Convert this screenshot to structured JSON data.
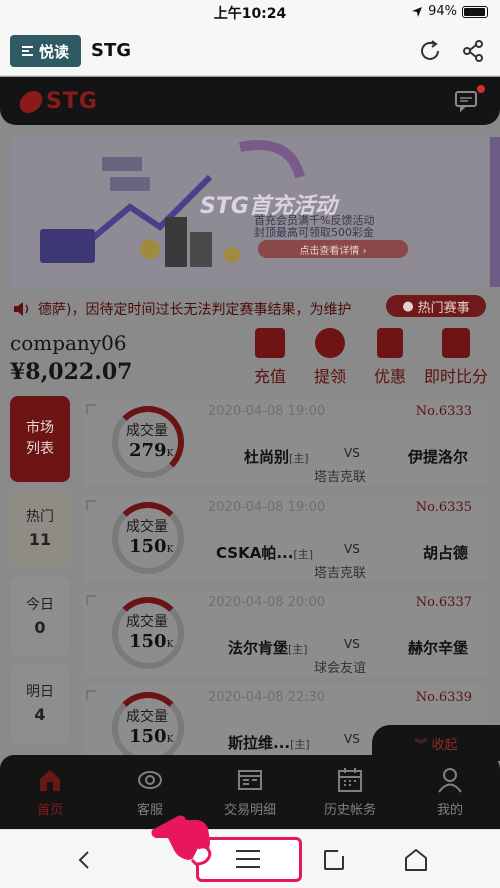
{
  "status": {
    "time": "上午10:24",
    "battery": "94%",
    "battery_level": 0.94
  },
  "header": {
    "reader_label": "悦读",
    "title": "STG"
  },
  "topbar": {
    "logo": "STG"
  },
  "banner": {
    "brand": "STG首充活动",
    "line1": "首充会员满千%反馈活动",
    "line2": "封顶最高可领取500彩金",
    "cta": "点击查看详情 ›"
  },
  "notice": {
    "text": "德萨)，因待定时间过长无法判定赛事结果，为维护",
    "hot_button": "热门赛事"
  },
  "account": {
    "name": "company06",
    "balance": "¥8,022.07"
  },
  "quick_actions": [
    {
      "label": "充值",
      "icon": "deposit-icon"
    },
    {
      "label": "提领",
      "icon": "withdraw-icon"
    },
    {
      "label": "优惠",
      "icon": "coupon-icon"
    },
    {
      "label": "即时比分",
      "icon": "scoreboard-icon"
    }
  ],
  "side_tabs": [
    {
      "label": "市场\n列表",
      "line1": "市场",
      "line2": "列表",
      "active": true
    },
    {
      "line1": "热门",
      "line2": "11"
    },
    {
      "line1": "今日",
      "line2": "0"
    },
    {
      "line1": "明日",
      "line2": "4"
    }
  ],
  "matches": [
    {
      "vol_label": "成交量",
      "volume": "279",
      "unit": "K",
      "date": "2020-04-08 19:00",
      "no": "No.6333",
      "home": "杜尚别",
      "home_tag": "[主]",
      "vs": "VS",
      "away": "伊提洛尔",
      "league": "塔吉克联"
    },
    {
      "vol_label": "成交量",
      "volume": "150",
      "unit": "K",
      "date": "2020-04-08 19:00",
      "no": "No.6335",
      "home": "CSKA帕...",
      "home_tag": "[主]",
      "vs": "VS",
      "away": "胡占德",
      "league": "塔吉克联"
    },
    {
      "vol_label": "成交量",
      "volume": "150",
      "unit": "K",
      "date": "2020-04-08 20:00",
      "no": "No.6337",
      "home": "法尔肯堡",
      "home_tag": "[主]",
      "vs": "VS",
      "away": "赫尔辛堡",
      "league": "球会友谊"
    },
    {
      "vol_label": "成交量",
      "volume": "150",
      "unit": "K",
      "date": "2020-04-08 22:30",
      "no": "No.6339",
      "home": "斯拉维...",
      "home_tag": "[主]",
      "vs": "VS",
      "away": "",
      "league": ""
    }
  ],
  "collapse_label": "收起",
  "tabbar": [
    {
      "label": "首页",
      "icon": "home-icon",
      "active": true
    },
    {
      "label": "客服",
      "icon": "support-icon"
    },
    {
      "label": "交易明细",
      "icon": "transactions-icon"
    },
    {
      "label": "历史帐务",
      "icon": "calendar-icon"
    },
    {
      "label": "我的",
      "icon": "profile-icon"
    }
  ]
}
